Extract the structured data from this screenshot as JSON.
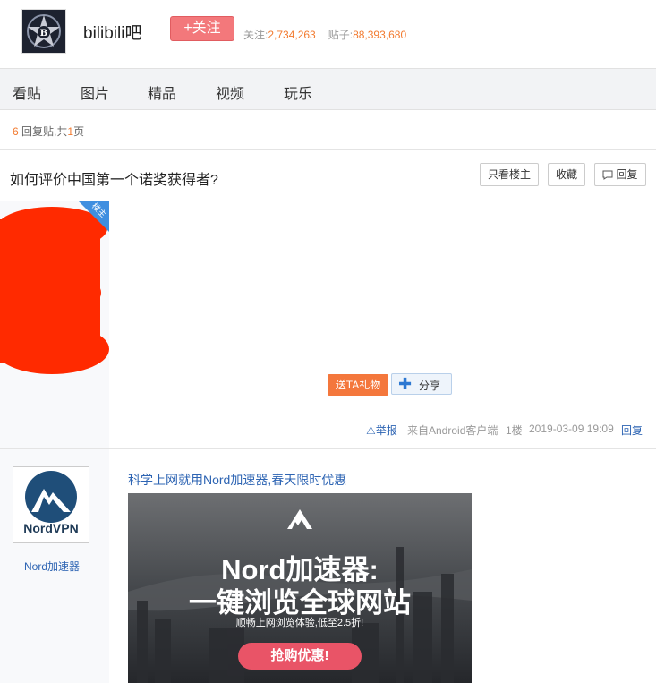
{
  "header": {
    "bar_name": "bilibili吧",
    "follow_label": "+关注",
    "follow_stat_label": "关注:",
    "follow_count": "2,734,263",
    "post_stat_label": "贴子:",
    "post_count": "88,393,680"
  },
  "nav": {
    "items": [
      "看贴",
      "图片",
      "精品",
      "视频",
      "玩乐"
    ]
  },
  "thread": {
    "reply_count": "6",
    "reply_suffix": "回复贴,共",
    "page_count": "1",
    "page_suffix": "页",
    "title": "如何评价中国第一个诺奖获得者?",
    "only_op_label": "只看楼主",
    "favorite_label": "收藏",
    "reply_label": "回复"
  },
  "post1": {
    "op_badge": "楼主",
    "gift_label": "送TA礼物",
    "share_label": "分享",
    "report_label": "举报",
    "source": "来自Android客户端",
    "floor": "1楼",
    "timestamp": "2019-03-09 19:09",
    "reply_label": "回复"
  },
  "ad": {
    "advertiser_logo_text": "NordVPN",
    "advertiser_name": "Nord加速器",
    "title": "科学上网就用Nord加速器,春天限时优惠",
    "headline_1": "Nord加速器:",
    "headline_2": "一键浏览全球网站",
    "subline": "顺畅上网浏览体验,低至2.5折!",
    "cta": "抢购优惠!"
  },
  "colors": {
    "accent_orange": "#f27a2f",
    "follow_red": "#f3787b",
    "link_blue": "#2d64b3",
    "redaction_red": "#ff2a00"
  }
}
